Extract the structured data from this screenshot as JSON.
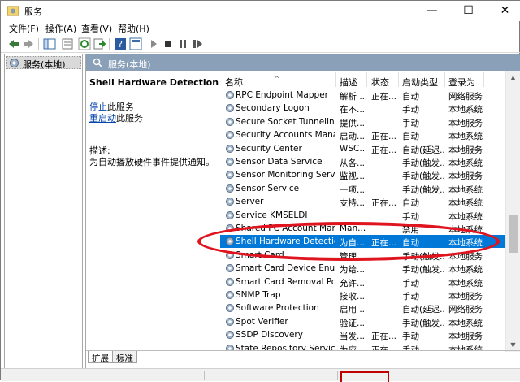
{
  "window": {
    "title": "服务",
    "minimize": "—",
    "maximize": "☐",
    "close": "✕"
  },
  "menu": [
    "文件(F)",
    "操作(A)",
    "查看(V)",
    "帮助(H)"
  ],
  "toolbar": {
    "icons": [
      "back-icon",
      "forward-icon",
      "console-tree-icon",
      "properties-icon",
      "refresh-icon",
      "export-icon",
      "help-icon",
      "view-icon",
      "start-icon",
      "stop-icon",
      "pause-icon",
      "restart-icon"
    ]
  },
  "tree": {
    "item": "服务(本地)"
  },
  "pane": {
    "header": "服务(本地)",
    "service_name": "Shell Hardware Detection",
    "stop_link": "停止",
    "stop_suffix": "此服务",
    "restart_link": "重启动",
    "restart_suffix": "此服务",
    "desc_label": "描述:",
    "desc_text": "为自动播放硬件事件提供通知。"
  },
  "columns": {
    "name": "名称",
    "desc": "描述",
    "status": "状态",
    "startup": "启动类型",
    "logon": "登录为"
  },
  "rows": [
    {
      "name": "RPC Endpoint Mapper",
      "desc": "解析 ...",
      "status": "正在...",
      "startup": "自动",
      "logon": "网络服务"
    },
    {
      "name": "Secondary Logon",
      "desc": "在不...",
      "status": "",
      "startup": "手动",
      "logon": "本地系统"
    },
    {
      "name": "Secure Socket Tunneling ...",
      "desc": "提供...",
      "status": "",
      "startup": "手动",
      "logon": "本地服务"
    },
    {
      "name": "Security Accounts Manag...",
      "desc": "启动...",
      "status": "正在...",
      "startup": "自动",
      "logon": "本地系统"
    },
    {
      "name": "Security Center",
      "desc": "WSC...",
      "status": "正在...",
      "startup": "自动(延迟...",
      "logon": "本地服务"
    },
    {
      "name": "Sensor Data Service",
      "desc": "从各...",
      "status": "",
      "startup": "手动(触发...",
      "logon": "本地系统"
    },
    {
      "name": "Sensor Monitoring Service",
      "desc": "监视...",
      "status": "",
      "startup": "手动(触发...",
      "logon": "本地服务"
    },
    {
      "name": "Sensor Service",
      "desc": "一项...",
      "status": "",
      "startup": "手动(触发...",
      "logon": "本地系统"
    },
    {
      "name": "Server",
      "desc": "支持...",
      "status": "正在...",
      "startup": "自动",
      "logon": "本地系统"
    },
    {
      "name": "Service KMSELDI",
      "desc": "",
      "status": "",
      "startup": "手动",
      "logon": "本地系统"
    },
    {
      "name": "Shared PC Account Mana...",
      "desc": "Man...",
      "status": "",
      "startup": "禁用",
      "logon": "本地系统"
    },
    {
      "name": "Shell Hardware Detection",
      "desc": "为自...",
      "status": "正在...",
      "startup": "自动",
      "logon": "本地系统"
    },
    {
      "name": "Smart Card",
      "desc": "管理...",
      "status": "",
      "startup": "手动(触发...",
      "logon": "本地服务"
    },
    {
      "name": "Smart Card Device Enum...",
      "desc": "为给...",
      "status": "",
      "startup": "手动(触发...",
      "logon": "本地系统"
    },
    {
      "name": "Smart Card Removal Poli...",
      "desc": "允许...",
      "status": "",
      "startup": "手动",
      "logon": "本地系统"
    },
    {
      "name": "SNMP Trap",
      "desc": "接收...",
      "status": "",
      "startup": "手动",
      "logon": "本地服务"
    },
    {
      "name": "Software Protection",
      "desc": "启用 ...",
      "status": "",
      "startup": "自动(延迟...",
      "logon": "网络服务"
    },
    {
      "name": "Spot Verifier",
      "desc": "验证...",
      "status": "",
      "startup": "手动(触发...",
      "logon": "本地系统"
    },
    {
      "name": "SSDP Discovery",
      "desc": "当发...",
      "status": "正在...",
      "startup": "手动",
      "logon": "本地服务"
    },
    {
      "name": "State Repository Service",
      "desc": "为应...",
      "status": "正在...",
      "startup": "手动",
      "logon": "本地系统"
    }
  ],
  "selected_row": 11,
  "tabs": [
    "扩展",
    "标准"
  ],
  "colors": {
    "selection": "#0078d7",
    "header": "#8aa0b8",
    "annotation": "#e0141e"
  }
}
